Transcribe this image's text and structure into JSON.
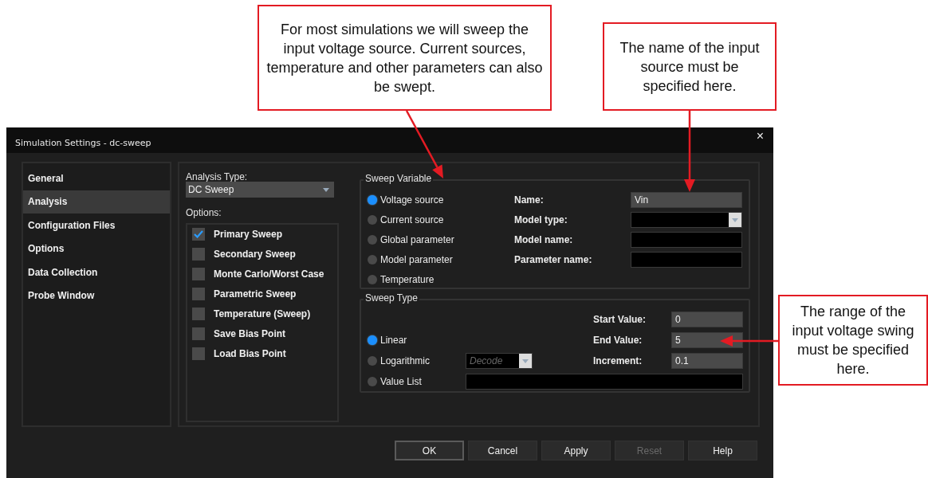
{
  "callouts": [
    {
      "text": "For most simulations we will sweep the input voltage source.  Current sources, temperature and other parameters can also be swept."
    },
    {
      "text": "The name of the input source must be specified here."
    },
    {
      "text": "The range of the input voltage swing must be specified here."
    }
  ],
  "window": {
    "title": "Simulation Settings - dc-sweep",
    "close": "×"
  },
  "sidebar": {
    "items": [
      {
        "label": "General",
        "selected": false
      },
      {
        "label": "Analysis",
        "selected": true
      },
      {
        "label": "Configuration Files",
        "selected": false
      },
      {
        "label": "Options",
        "selected": false
      },
      {
        "label": "Data Collection",
        "selected": false
      },
      {
        "label": "Probe Window",
        "selected": false
      }
    ]
  },
  "analysis_type": {
    "label": "Analysis Type:",
    "value": "DC Sweep"
  },
  "options": {
    "label": "Options:",
    "items": [
      {
        "label": "Primary Sweep",
        "checked": true
      },
      {
        "label": "Secondary Sweep",
        "checked": false
      },
      {
        "label": "Monte Carlo/Worst Case",
        "checked": false
      },
      {
        "label": "Parametric Sweep",
        "checked": false
      },
      {
        "label": "Temperature (Sweep)",
        "checked": false
      },
      {
        "label": "Save Bias Point",
        "checked": false
      },
      {
        "label": "Load Bias Point",
        "checked": false
      }
    ]
  },
  "sweep_variable": {
    "title": "Sweep Variable",
    "sources": [
      {
        "label": "Voltage source",
        "selected": true
      },
      {
        "label": "Current source",
        "selected": false
      },
      {
        "label": "Global parameter",
        "selected": false
      },
      {
        "label": "Model parameter",
        "selected": false
      },
      {
        "label": "Temperature",
        "selected": false
      }
    ],
    "fields": [
      {
        "label": "Name:",
        "value": "Vin",
        "kind": "text",
        "disabled": false
      },
      {
        "label": "Model type:",
        "kind": "dropdown",
        "disabled": true
      },
      {
        "label": "Model name:",
        "kind": "text",
        "disabled": true
      },
      {
        "label": "Parameter name:",
        "kind": "text",
        "disabled": true
      }
    ]
  },
  "sweep_type": {
    "title": "Sweep Type",
    "types": [
      {
        "label": "Linear",
        "selected": true
      },
      {
        "label": "Logarithmic",
        "selected": false
      },
      {
        "label": "Value List",
        "selected": false
      }
    ],
    "log_base": {
      "value": "Decode",
      "disabled": true
    },
    "ranges": [
      {
        "label": "Start Value:",
        "value": "0"
      },
      {
        "label": "End Value:",
        "value": "5"
      },
      {
        "label": "Increment:",
        "value": "0.1"
      }
    ]
  },
  "buttons": [
    {
      "label": "OK",
      "disabled": false,
      "default": true
    },
    {
      "label": "Cancel",
      "disabled": false,
      "default": false
    },
    {
      "label": "Apply",
      "disabled": false,
      "default": false
    },
    {
      "label": "Reset",
      "disabled": true,
      "default": false
    },
    {
      "label": "Help",
      "disabled": false,
      "default": false
    }
  ]
}
